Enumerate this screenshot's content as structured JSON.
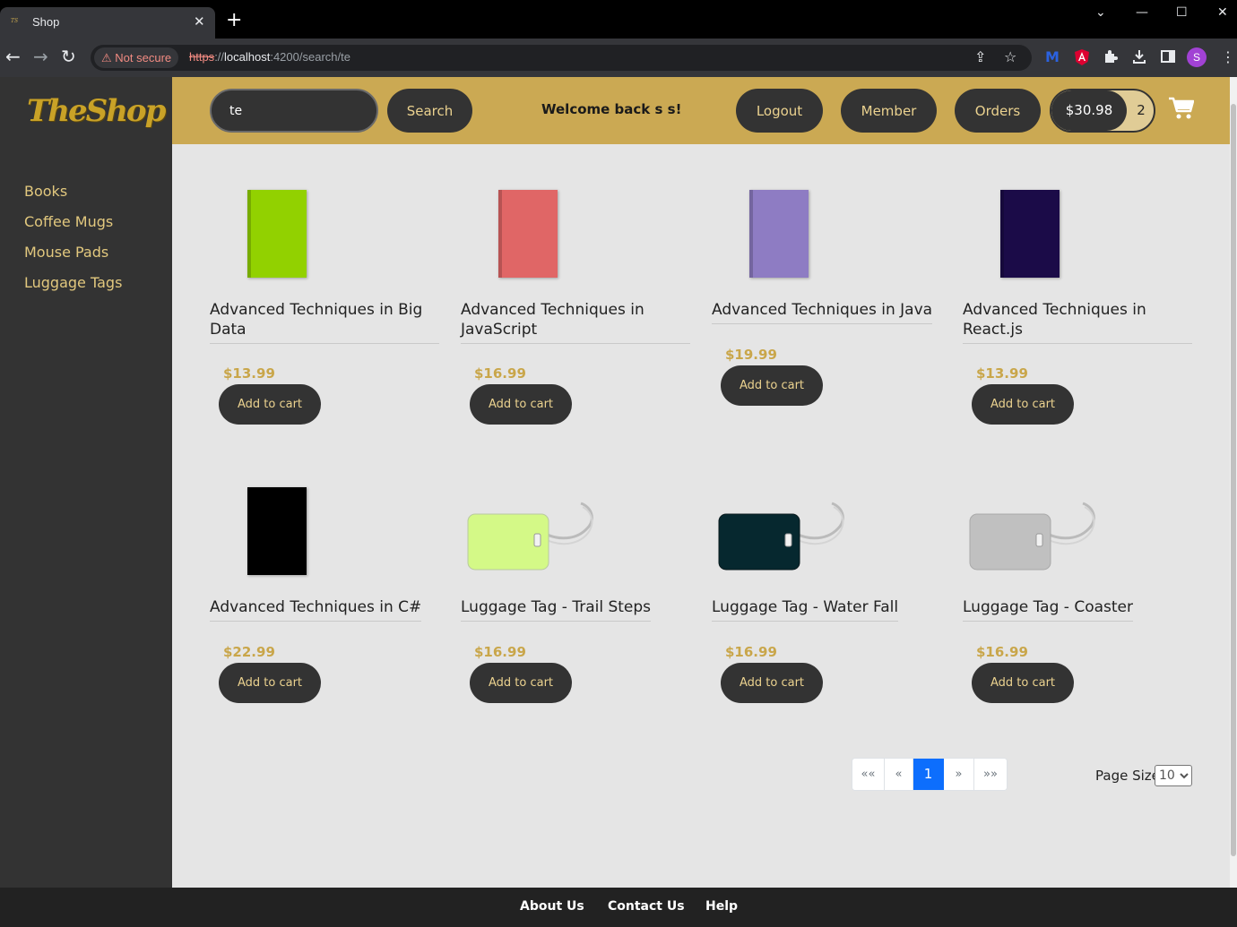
{
  "browser": {
    "tab_title": "Shop",
    "tab_close": "✕",
    "new_tab": "+",
    "window_controls": [
      "⌄",
      "—",
      "☐",
      "✕"
    ],
    "not_secure": "⚠ Not secure",
    "url_scheme": "https",
    "url_sep": "://",
    "url_host": "localhost",
    "url_path": ":4200/search/te",
    "profile_initial": "S"
  },
  "logo": {
    "text": "TheShop"
  },
  "sidebar": {
    "items": [
      {
        "label": "Books"
      },
      {
        "label": "Coffee Mugs"
      },
      {
        "label": "Mouse Pads"
      },
      {
        "label": "Luggage Tags"
      }
    ]
  },
  "header": {
    "search_value": "te",
    "search_button": "Search",
    "welcome": "Welcome back s s!",
    "logout": "Logout",
    "member": "Member",
    "orders": "Orders",
    "cart_total": "$30.98",
    "cart_count": "2"
  },
  "products": [
    {
      "name_l1": "Advanced Techniques in Big",
      "name_l2": "Data",
      "price": "$13.99",
      "button": "Add to cart",
      "color": "#92d100"
    },
    {
      "name_l1": "Advanced Techniques in",
      "name_l2": "JavaScript",
      "price": "$16.99",
      "button": "Add to cart",
      "color": "#e06666"
    },
    {
      "name_l1": "Advanced Techniques in Java",
      "name_l2": "",
      "price": "$19.99",
      "button": "Add to cart",
      "color": "#8e7cc3"
    },
    {
      "name_l1": "Advanced Techniques in",
      "name_l2": "React.js",
      "price": "$13.99",
      "button": "Add to cart",
      "color": "#1b0b48"
    },
    {
      "name_l1": "Advanced Techniques in C#",
      "name_l2": "",
      "price": "$22.99",
      "button": "Add to cart",
      "color": "#000000"
    },
    {
      "name_l1": "Luggage Tag - Trail Steps",
      "name_l2": "",
      "price": "$16.99",
      "button": "Add to cart",
      "color": "#d4f987"
    },
    {
      "name_l1": "Luggage Tag - Water Fall",
      "name_l2": "",
      "price": "$16.99",
      "button": "Add to cart",
      "color": "#06282f"
    },
    {
      "name_l1": "Luggage Tag - Coaster",
      "name_l2": "",
      "price": "$16.99",
      "button": "Add to cart",
      "color": "#c0c0c0"
    }
  ],
  "pagination": {
    "first": "««",
    "prev": "«",
    "current": "1",
    "next": "»",
    "last": "»»",
    "page_size_label": "Page Size",
    "page_size_value": "10"
  },
  "footer": {
    "about": "About Us",
    "contact": "Contact Us",
    "help": "Help"
  }
}
